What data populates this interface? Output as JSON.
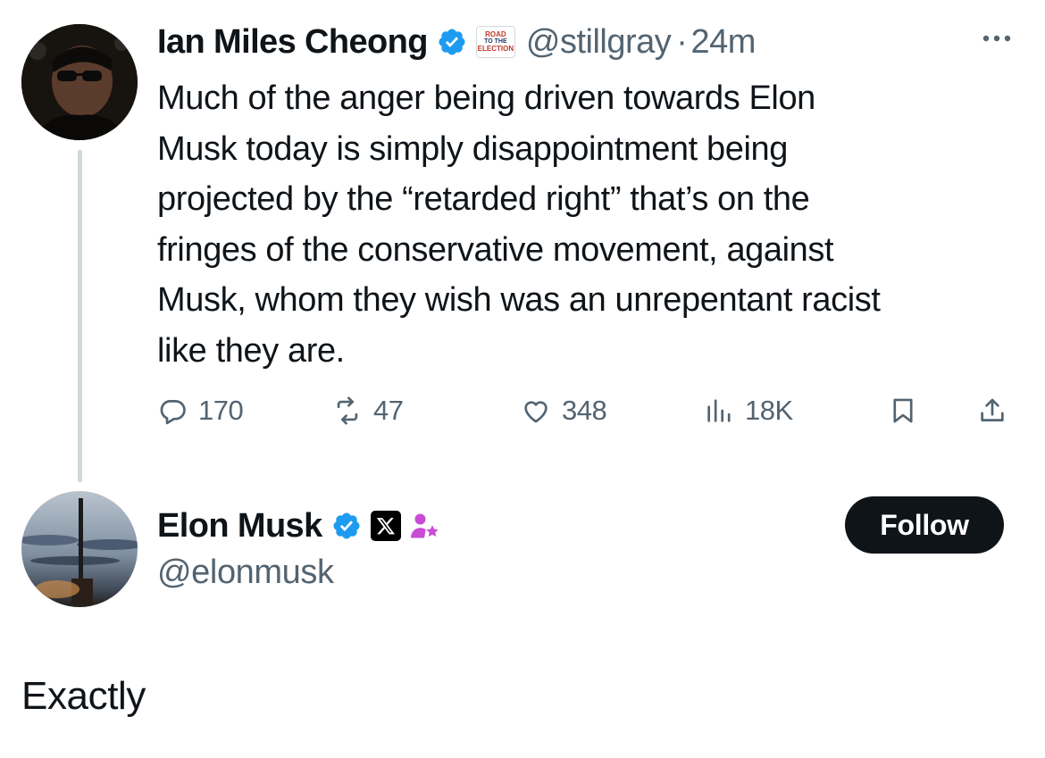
{
  "original_post": {
    "author": {
      "display_name": "Ian Miles Cheong",
      "handle": "@stillgray",
      "verified_badge": "verified-badge-icon",
      "affiliation_badge": {
        "line1": "ROAD",
        "line2": "TO THE",
        "line3": "ELECTION"
      }
    },
    "separator": "·",
    "time": "24m",
    "text": "Much of the anger being driven towards Elon\nMusk today is simply disappointment being\nprojected by the “retarded right” that’s on the\nfringes of the conservative movement, against\nMusk, whom they wish was an unrepentant racist\nlike they are.",
    "actions": {
      "replies": "170",
      "reposts": "47",
      "likes": "348",
      "views": "18K"
    }
  },
  "reply_post": {
    "author": {
      "display_name": "Elon Musk",
      "handle": "@elonmusk",
      "verified_badge": "verified-badge-icon",
      "affiliation_badge": "x-logo-icon",
      "role_icon": "person-star-icon"
    },
    "follow_label": "Follow",
    "text": "Exactly"
  },
  "colors": {
    "text_primary": "#0f1419",
    "text_secondary": "#536471",
    "verified_blue": "#1d9bf0",
    "thread_line": "#cfd9de",
    "follow_button_bg": "#0f1419",
    "role_icon": "#c94bd6"
  }
}
